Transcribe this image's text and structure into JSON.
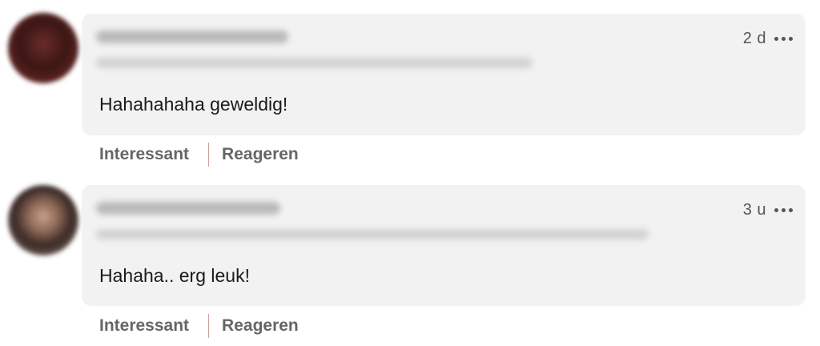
{
  "comments": [
    {
      "time": "2 d",
      "text": "Hahahahaha geweldig!",
      "actions": {
        "react": "Interessant",
        "reply": "Reageren"
      }
    },
    {
      "time": "3 u",
      "text": "Hahaha.. erg leuk!",
      "actions": {
        "react": "Interessant",
        "reply": "Reageren"
      }
    }
  ],
  "icons": {
    "more": "more-horizontal-icon"
  },
  "colors": {
    "bubble": "#f2f2f2",
    "action_text": "#666666",
    "divider": "#c8a49a"
  }
}
